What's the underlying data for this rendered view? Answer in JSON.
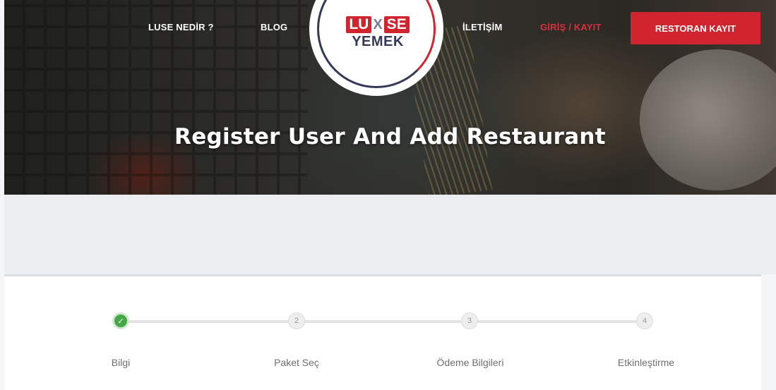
{
  "nav": {
    "what_is": "LUSE NEDİR ?",
    "blog": "BLOG",
    "contact": "İLETİŞİM",
    "login": "GİRİŞ / KAYIT",
    "register_restaurant": "RESTORAN KAYIT"
  },
  "logo": {
    "line1_a": "LU",
    "line1_x": "X",
    "line1_b": "SE",
    "line2": "YEMEK"
  },
  "hero": {
    "title": "Register User And Add Restaurant"
  },
  "wizard": {
    "steps": [
      {
        "number": "✓",
        "label": "Bilgi",
        "state": "completed"
      },
      {
        "number": "2",
        "label": "Paket Seç",
        "state": "pending"
      },
      {
        "number": "3",
        "label": "Ödeme Bilgileri",
        "state": "pending"
      },
      {
        "number": "4",
        "label": "Etkinleştirme",
        "state": "pending"
      }
    ]
  },
  "colors": {
    "brand_red": "#d0252f",
    "brand_navy": "#34395a",
    "step_done": "#45a845"
  }
}
